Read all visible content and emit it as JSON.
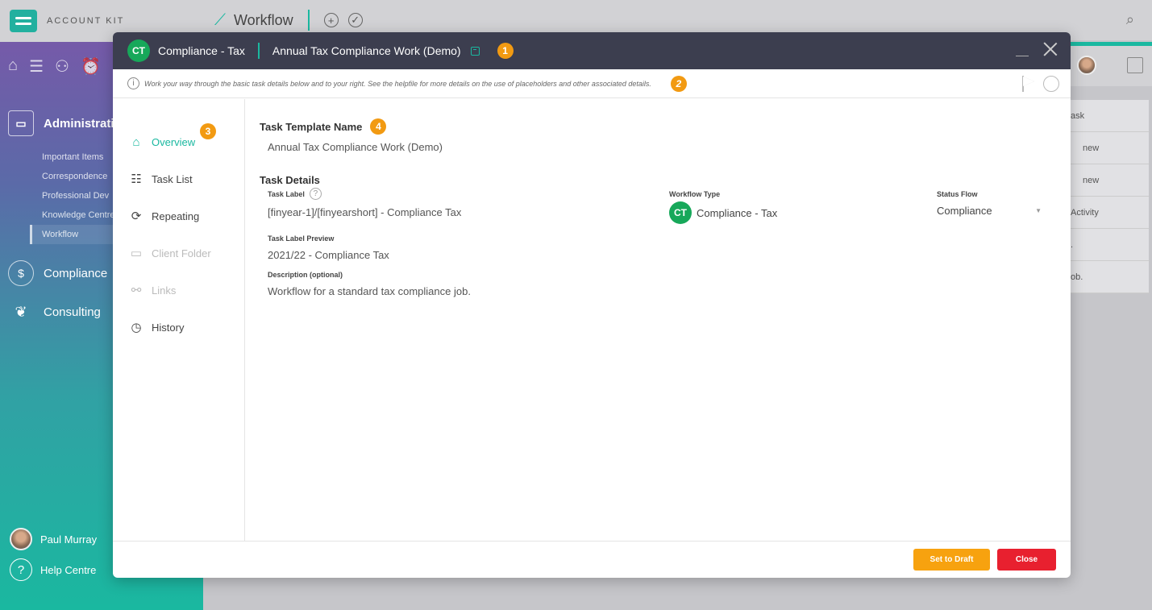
{
  "app": {
    "brand": "ACCOUNT KIT",
    "module_title": "Workflow",
    "sidebar": {
      "section_admin": "Administration",
      "admin_items": [
        "Important Items",
        "Correspondence",
        "Professional Dev",
        "Knowledge Centre",
        "Workflow"
      ],
      "section_compliance": "Compliance",
      "section_consulting": "Consulting",
      "user_name": "Paul Murray",
      "help": "Help Centre"
    },
    "right_list": [
      "ask",
      "new",
      "new",
      "Activity",
      ".",
      "ob."
    ]
  },
  "modal": {
    "badge": "CT",
    "workflow_type": "Compliance - Tax",
    "title": "Annual Tax Compliance Work (Demo)",
    "step_badges": [
      "1",
      "2",
      "3",
      "4"
    ],
    "info_text": "Work your way through the basic task details below and to your right. See the helpfile for more details on the use of placeholders and other associated details.",
    "nav": [
      {
        "label": "Overview",
        "icon": "home-icon"
      },
      {
        "label": "Task List",
        "icon": "checklist-icon"
      },
      {
        "label": "Repeating",
        "icon": "repeat-icon"
      },
      {
        "label": "Client Folder",
        "icon": "folder-icon"
      },
      {
        "label": "Links",
        "icon": "link-icon"
      },
      {
        "label": "History",
        "icon": "history-icon"
      }
    ],
    "content": {
      "template_name_label": "Task Template Name",
      "template_name_value": "Annual Tax Compliance Work (Demo)",
      "task_details_label": "Task Details",
      "task_label_label": "Task Label",
      "task_label_value": "[finyear-1]/[finyearshort] - Compliance Tax",
      "workflow_type_label": "Workflow Type",
      "workflow_type_badge": "CT",
      "workflow_type_value": "Compliance - Tax",
      "status_flow_label": "Status Flow",
      "status_flow_value": "Compliance",
      "preview_label": "Task Label Preview",
      "preview_value": "2021/22 - Compliance Tax",
      "description_label": "Description (optional)",
      "description_value": "Workflow for a standard tax compliance job."
    },
    "footer": {
      "draft_label": "Set to Draft",
      "close_label": "Close"
    }
  },
  "colors": {
    "accent": "#1ab8a0",
    "header_bg": "#3c3e4f",
    "badge_green": "#17a85a",
    "step_badge": "#f29a12",
    "draft_button": "#f7a20f",
    "close_button": "#e8202f"
  }
}
